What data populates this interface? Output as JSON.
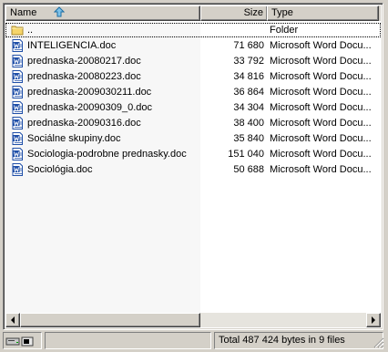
{
  "header": {
    "name_label": "Name",
    "size_label": "Size",
    "type_label": "Type"
  },
  "files": [
    {
      "name": "..",
      "size": "",
      "type": "Folder",
      "icon": "folder-icon"
    },
    {
      "name": "INTELIGENCIA.doc",
      "size": "71 680",
      "type": "Microsoft Word Docu...",
      "icon": "word-doc-icon"
    },
    {
      "name": "prednaska-20080217.doc",
      "size": "33 792",
      "type": "Microsoft Word Docu...",
      "icon": "word-doc-icon"
    },
    {
      "name": "prednaska-20080223.doc",
      "size": "34 816",
      "type": "Microsoft Word Docu...",
      "icon": "word-doc-icon"
    },
    {
      "name": "prednaska-2009030211.doc",
      "size": "36 864",
      "type": "Microsoft Word Docu...",
      "icon": "word-doc-icon"
    },
    {
      "name": "prednaska-20090309_0.doc",
      "size": "34 304",
      "type": "Microsoft Word Docu...",
      "icon": "word-doc-icon"
    },
    {
      "name": "prednaska-20090316.doc",
      "size": "38 400",
      "type": "Microsoft Word Docu...",
      "icon": "word-doc-icon"
    },
    {
      "name": "Sociálne skupiny.doc",
      "size": "35 840",
      "type": "Microsoft Word Docu...",
      "icon": "word-doc-icon"
    },
    {
      "name": "Sociologia-podrobne prednasky.doc",
      "size": "151 040",
      "type": "Microsoft Word Docu...",
      "icon": "word-doc-icon"
    },
    {
      "name": "Sociológia.doc",
      "size": "50 688",
      "type": "Microsoft Word Docu...",
      "icon": "word-doc-icon"
    }
  ],
  "status": {
    "left": "",
    "middle": "",
    "summary": "Total 487 424 bytes in 9 files"
  },
  "icons": {
    "sort": "sort-ascending-icon",
    "drive": "drive-icon",
    "scroll_left": "scroll-left-icon",
    "scroll_right": "scroll-right-icon"
  },
  "colors": {
    "face": "#d4d0c8",
    "list_bg": "#ffffff",
    "sort_arrow": "#1c6ea4",
    "word_icon": "#1f4fa8"
  }
}
